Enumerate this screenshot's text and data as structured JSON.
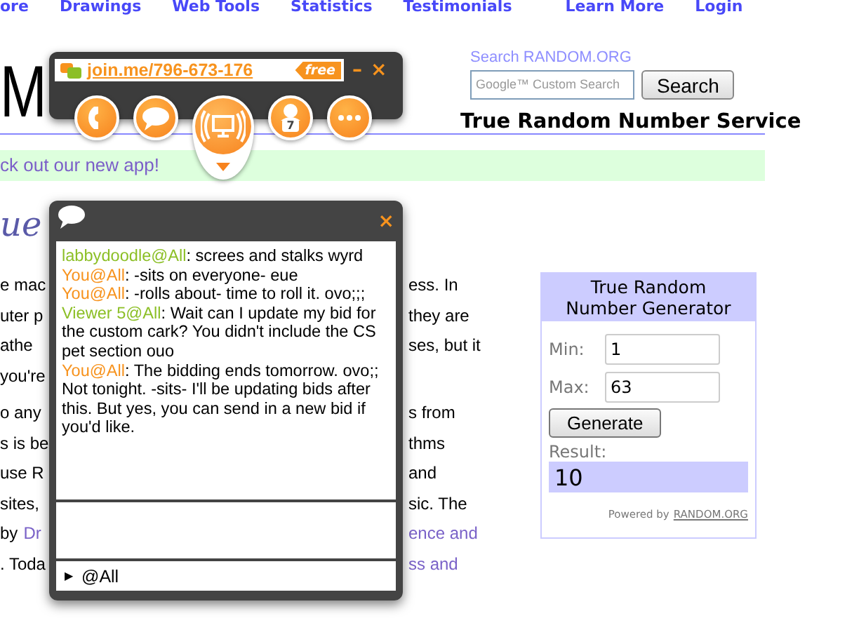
{
  "nav_links": [
    "ore",
    "Drawings",
    "Web Tools",
    "Statistics",
    "Testimonials",
    "Learn More",
    "Login"
  ],
  "logo": "M",
  "search": {
    "label": "Search RANDOM.ORG",
    "placeholder": "Google™ Custom Search",
    "button": "Search"
  },
  "tagline": "True Random Number Service",
  "banner": "ck out our new app!",
  "heading": "ue",
  "paragraphs": [
    {
      "lines": [
        {
          "left": [
            {
              "text": "e mac",
              "link": false
            }
          ],
          "right": [
            {
              "text": "ess. In",
              "link": false
            }
          ]
        },
        {
          "left": [
            {
              "text": "uter p",
              "link": false
            }
          ],
          "right": [
            {
              "text": "they are",
              "link": false
            }
          ]
        },
        {
          "left": [
            {
              "text": "athe",
              "link": false
            }
          ],
          "right": [
            {
              "text": "ses, but it",
              "link": false
            }
          ]
        },
        {
          "left": [
            {
              "text": "you're",
              "link": false
            }
          ]
        }
      ]
    },
    {
      "lines": [
        {
          "left": [
            {
              "text": "o any",
              "link": false
            }
          ],
          "right": [
            {
              "text": "s from",
              "link": false
            }
          ]
        },
        {
          "left": [
            {
              "text": "s is be",
              "link": false
            }
          ],
          "right": [
            {
              "text": "thms",
              "link": false
            }
          ]
        },
        {
          "left": [
            {
              "text": "use R",
              "link": false
            }
          ],
          "right": [
            {
              "text": "and",
              "link": false
            }
          ]
        },
        {
          "left": [
            {
              "text": "sites,",
              "link": false
            }
          ],
          "right": [
            {
              "text": "sic. The",
              "link": false
            }
          ]
        },
        {
          "left": [
            {
              "text": "by",
              "link": false
            },
            {
              "text": "Dr",
              "link": true
            }
          ],
          "right": [
            {
              "text": "ence and",
              "link": true
            }
          ]
        },
        {
          "left": [
            {
              "text": ". Toda",
              "link": false
            }
          ],
          "right": [
            {
              "text": "ss and",
              "link": true
            }
          ]
        }
      ]
    }
  ],
  "generator": {
    "title": "True Random Number Generator",
    "fields": [
      {
        "label": "Min:",
        "value": "1"
      },
      {
        "label": "Max:",
        "value": "63"
      }
    ],
    "button": "Generate",
    "result_label": "Result:",
    "result": "10",
    "powered_by": "Powered by",
    "powered_link": "RANDOM.ORG"
  },
  "toolbar": {
    "url": "join.me/796-673-176",
    "badge": "free",
    "minimize": "–",
    "close": "×",
    "buttons": [
      {
        "kind": "phone",
        "selected": false
      },
      {
        "kind": "chat",
        "selected": false
      },
      {
        "kind": "screen",
        "selected": true
      },
      {
        "kind": "people",
        "badge": "7",
        "selected": false
      },
      {
        "kind": "more",
        "selected": false
      }
    ]
  },
  "chat": {
    "close": "×",
    "send_arrow": "▶",
    "recipient": "@All",
    "messages": [
      {
        "sender": "labbydoodle@All",
        "color": "#8cbf26",
        "text": ": screes and stalks wyrd"
      },
      {
        "sender": "You@All",
        "color": "#f7931e",
        "text": ": -sits on everyone- eue"
      },
      {
        "sender": "You@All",
        "color": "#f7931e",
        "text": ": -rolls about- time to roll it. ovo;;;"
      },
      {
        "sender": "Viewer 5@All",
        "color": "#8cbf26",
        "text": ": Wait can I update my bid for the custom cark? You didn't include the CS pet section ouo"
      },
      {
        "sender": "You@All",
        "color": "#f7931e",
        "text": ": The bidding ends tomorrow. ovo;; Not tonight. -sits- I'll be updating bids after this. But yes, you can send in a new bid if you'd like."
      }
    ]
  }
}
